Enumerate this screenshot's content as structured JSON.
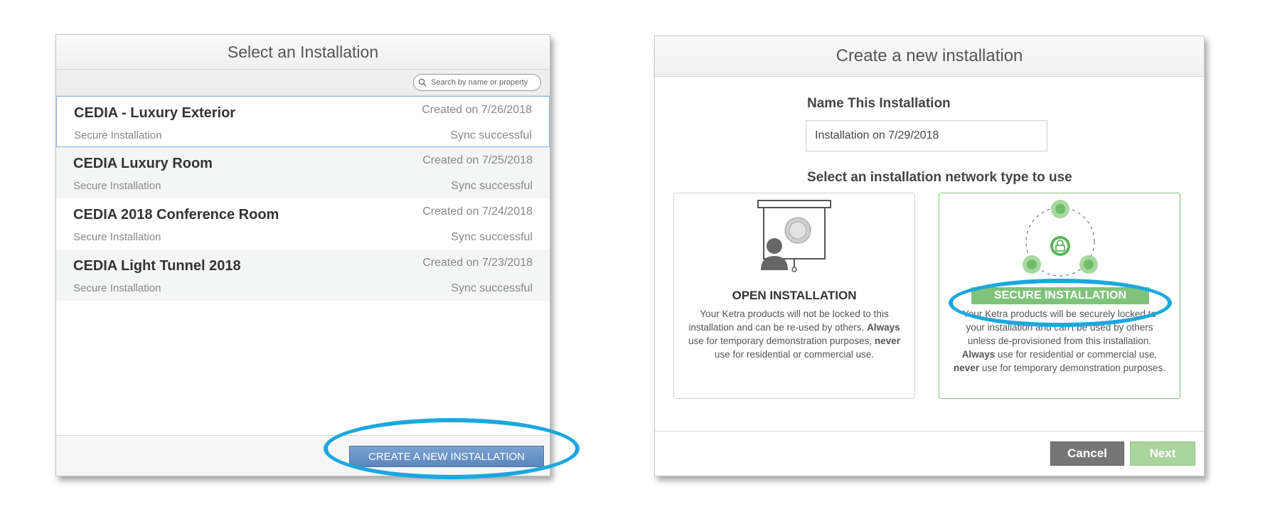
{
  "select_panel": {
    "title": "Select an Installation",
    "search": {
      "placeholder": "Search by name or property",
      "value": ""
    },
    "installations": [
      {
        "name": "CEDIA - Luxury Exterior",
        "created": "Created on 7/26/2018",
        "type": "Secure Installation",
        "status": "Sync successful"
      },
      {
        "name": "CEDIA Luxury Room",
        "created": "Created on 7/25/2018",
        "type": "Secure Installation",
        "status": "Sync successful"
      },
      {
        "name": "CEDIA 2018 Conference Room",
        "created": "Created on 7/24/2018",
        "type": "Secure Installation",
        "status": "Sync successful"
      },
      {
        "name": "CEDIA Light Tunnel 2018",
        "created": "Created on 7/23/2018",
        "type": "Secure Installation",
        "status": "Sync successful"
      }
    ],
    "create_button": "CREATE A NEW INSTALLATION"
  },
  "create_panel": {
    "title": "Create a new installation",
    "name_label": "Name This Installation",
    "name_value": "Installation on 7/29/2018",
    "network_label": "Select an installation network type to use",
    "open_card": {
      "title": "OPEN INSTALLATION",
      "desc_1": "Your Ketra products will not be locked to this installation and can be re-used by others. ",
      "desc_bold_1": "Always",
      "desc_2": " use for temporary demonstration purposes, ",
      "desc_bold_2": "never",
      "desc_3": " use for residential or commercial use."
    },
    "secure_card": {
      "title": "SECURE INSTALLATION",
      "desc_1": "Your Ketra products will be securely locked to your installation and can't be used by others unless de-provisioned from this installation. ",
      "desc_bold_1": "Always",
      "desc_2": " use for residential or commercial use, ",
      "desc_bold_2": "never",
      "desc_3": " use for temporary demonstration purposes."
    },
    "cancel_button": "Cancel",
    "next_button": "Next"
  },
  "colors": {
    "highlight_ring": "#1aa8de",
    "primary_button": "#5b86bd",
    "secure_green": "#7fc27a",
    "cancel_gray": "#767676"
  }
}
